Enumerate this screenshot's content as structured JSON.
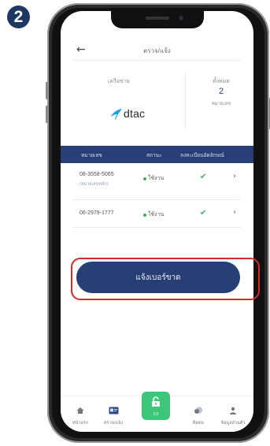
{
  "step_number": "2",
  "header": {
    "back_icon": "←",
    "title": "ตรวจ/แจ้ง"
  },
  "summary": {
    "network_label": "เครือข่าย",
    "operator_name": "dtac",
    "total_label": "ทั้งหมด",
    "total_count": "2",
    "total_unit": "หมายเลข"
  },
  "table": {
    "columns": [
      "หมายเลข",
      "สถานะ",
      "ลงทะเบียนอัตลักษณ์"
    ],
    "rows": [
      {
        "number": "08-3558-5065",
        "sub": "(หมายเลขหลัก)",
        "status": "ใช้งาน",
        "check": "✔",
        "chevron": "›"
      },
      {
        "number": "06-2979-1777",
        "sub": "",
        "status": "ใช้งาน",
        "check": "✔",
        "chevron": "›"
      }
    ]
  },
  "report_button": "แจ้งเบอร์ขาด",
  "bottom_nav": {
    "items": [
      {
        "label": "หน้าแรก",
        "icon": "home-icon"
      },
      {
        "label": "ตรวจ/แจ้ง",
        "icon": "id-card-icon"
      },
      {
        "label": "3.0",
        "icon": "unlock-icon"
      },
      {
        "label": "ติดต่อ",
        "icon": "chat-icon"
      },
      {
        "label": "ข้อมูลส่วนตัว",
        "icon": "person-icon"
      }
    ]
  },
  "colors": {
    "primary": "#273f75",
    "accent_green": "#3bc67a",
    "status_green": "#3db05f",
    "highlight_red": "#d42a2a",
    "dtac_blue": "#1aa3e0"
  }
}
